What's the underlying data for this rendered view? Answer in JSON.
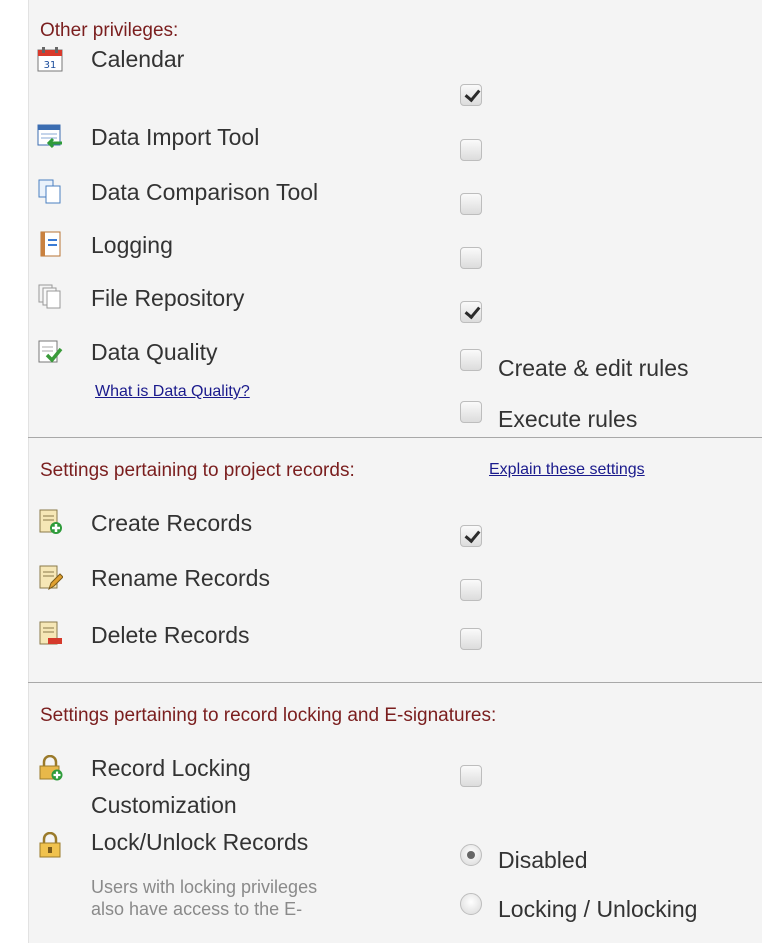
{
  "other_privileges": {
    "title": "Other privileges:",
    "items": [
      {
        "label": "Calendar",
        "icon": "calendar-icon",
        "checked": true
      },
      {
        "label": "Data Import Tool",
        "icon": "data-import-icon",
        "checked": false
      },
      {
        "label": "Data Comparison Tool",
        "icon": "data-comparison-icon",
        "checked": false
      },
      {
        "label": "Logging",
        "icon": "logging-icon",
        "checked": false
      },
      {
        "label": "File Repository",
        "icon": "file-repository-icon",
        "checked": true
      }
    ],
    "data_quality": {
      "label": "Data Quality",
      "icon": "data-quality-icon",
      "link": "What is Data Quality?",
      "options": [
        {
          "label": "Create & edit rules",
          "checked": false
        },
        {
          "label": "Execute rules",
          "checked": false
        }
      ]
    }
  },
  "project_records": {
    "title": "Settings pertaining to project records:",
    "link": "Explain these settings",
    "items": [
      {
        "label": "Create Records",
        "icon": "create-record-icon",
        "checked": true
      },
      {
        "label": "Rename Records",
        "icon": "rename-record-icon",
        "checked": false
      },
      {
        "label": "Delete Records",
        "icon": "delete-record-icon",
        "checked": false
      }
    ]
  },
  "record_locking": {
    "title": "Settings pertaining to record locking and E-signatures:",
    "customization": {
      "label_line1": "Record Locking",
      "label_line2": "Customization",
      "icon": "lock-customization-icon",
      "checked": false
    },
    "lock_unlock": {
      "label": "Lock/Unlock Records",
      "icon": "padlock-icon",
      "note_line1": "Users with locking privileges",
      "note_line2": "also have access to the E-",
      "options": [
        {
          "label": "Disabled",
          "selected": true
        },
        {
          "label": "Locking / Unlocking",
          "selected": false
        }
      ]
    }
  },
  "colors": {
    "section_title": "#7a1e1e",
    "link": "#1a1a8c",
    "panel_bg": "#f4f4f4"
  }
}
